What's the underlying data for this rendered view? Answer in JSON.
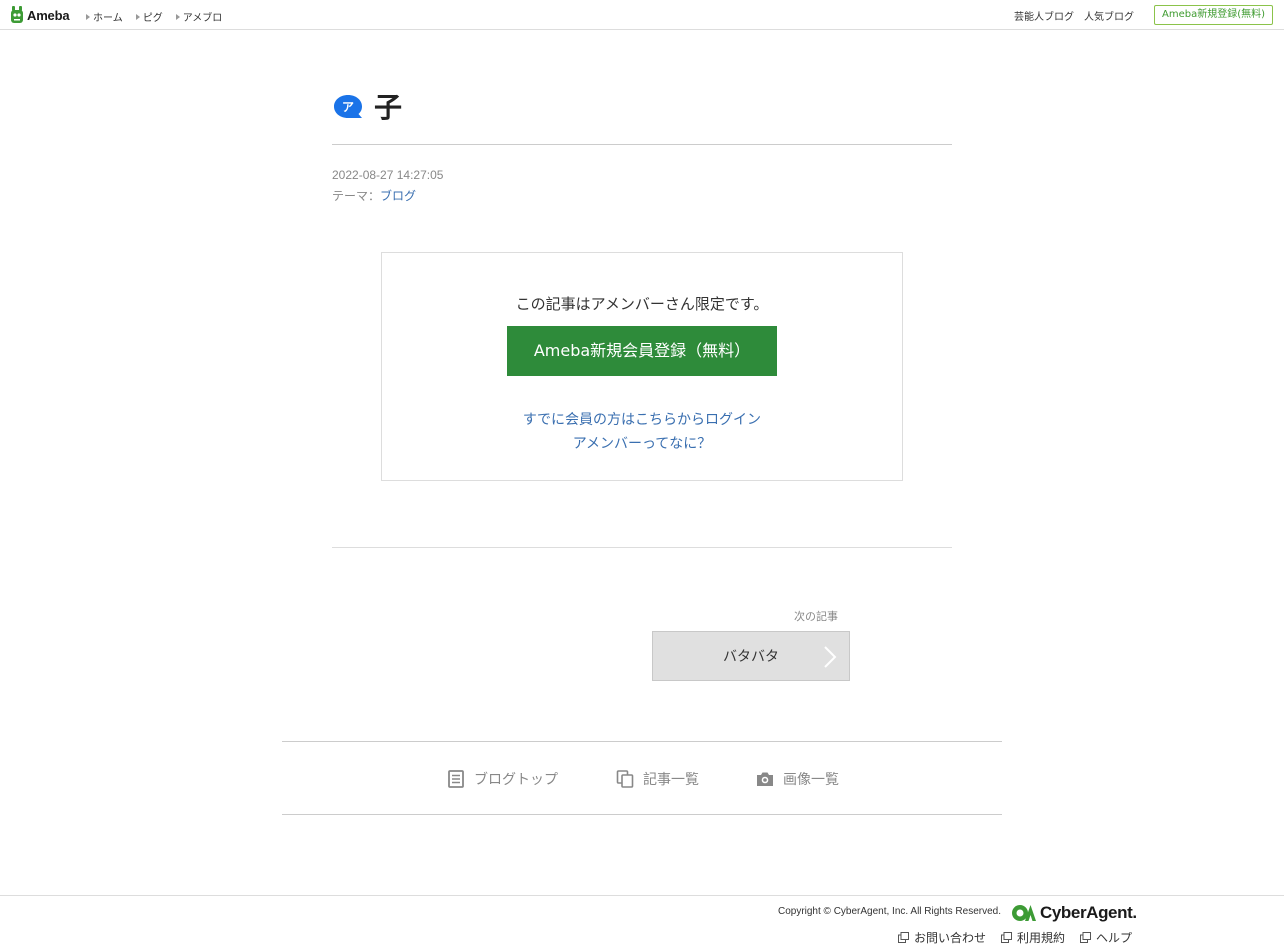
{
  "header": {
    "logo_text": "Ameba",
    "nav": [
      {
        "label": "ホーム"
      },
      {
        "label": "ピグ"
      },
      {
        "label": "アメブロ"
      }
    ],
    "right_links": [
      {
        "label": "芸能人ブログ"
      },
      {
        "label": "人気ブログ"
      }
    ],
    "signup_label": "Ameba新規登録(無料)"
  },
  "article": {
    "title": "子",
    "date": "2022-08-27 14:27:05",
    "theme_prefix": "テーマ：",
    "theme": "ブログ"
  },
  "member_box": {
    "message": "この記事はアメンバーさん限定です。",
    "signup_button": "Ameba新規会員登録（無料）",
    "login_link": "すでに会員の方はこちらからログイン",
    "what_link": "アメンバーってなに？"
  },
  "next_article": {
    "label": "次の記事",
    "title": "バタバタ"
  },
  "blog_nav": {
    "top": "ブログトップ",
    "list": "記事一覧",
    "images": "画像一覧"
  },
  "footer": {
    "copyright": "Copyright © CyberAgent, Inc. All Rights Reserved.",
    "brand": "CyberAgent.",
    "links": [
      {
        "label": "お問い合わせ"
      },
      {
        "label": "利用規約"
      },
      {
        "label": "ヘルプ"
      }
    ]
  },
  "colors": {
    "accent_green": "#2e8b3a",
    "link_blue": "#3a6fb0",
    "ameba_blue": "#1a73e8"
  }
}
